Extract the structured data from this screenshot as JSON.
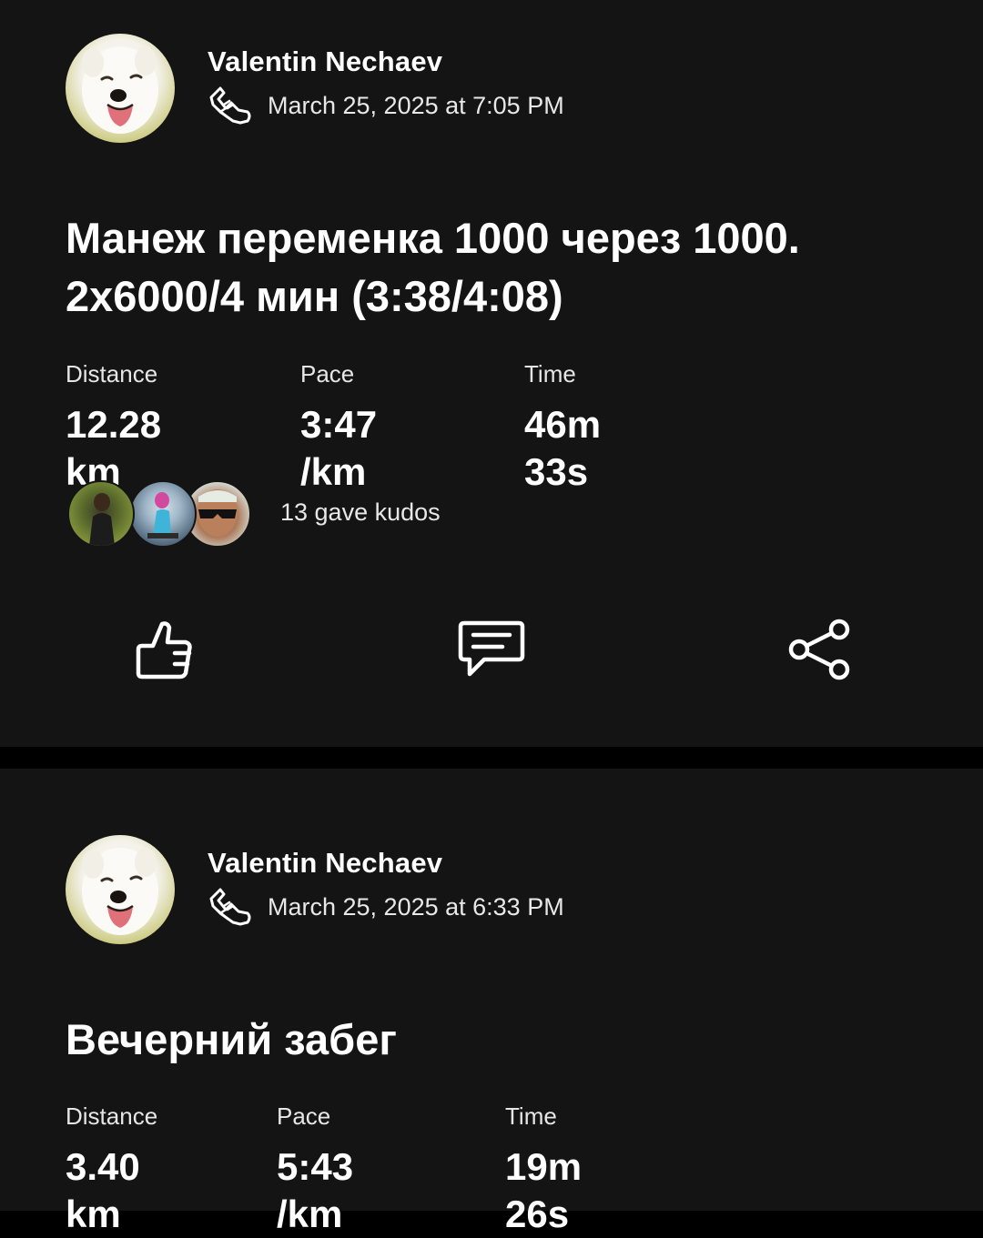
{
  "colors": {
    "background": "#000000",
    "card": "#141414",
    "text_primary": "#ffffff",
    "text_secondary": "#e8e8e8"
  },
  "activities": [
    {
      "athlete_name": "Valentin Nechaev",
      "activity_icon": "running-shoe-icon",
      "timestamp": "March 25, 2025 at 7:05 PM",
      "title": "Манеж переменка 1000 через 1000. 2х6000/4 мин (3:38/4:08)",
      "stats": [
        {
          "label": "Distance",
          "value": "12.28 km"
        },
        {
          "label": "Pace",
          "value": "3:47 /km"
        },
        {
          "label": "Time",
          "value": "46m 33s"
        }
      ],
      "kudos": {
        "text": "13 gave kudos"
      },
      "actions": [
        {
          "icon": "thumbs-up-icon"
        },
        {
          "icon": "comment-icon"
        },
        {
          "icon": "share-icon"
        }
      ]
    },
    {
      "athlete_name": "Valentin Nechaev",
      "activity_icon": "running-shoe-icon",
      "timestamp": "March 25, 2025 at 6:33 PM",
      "title": "Вечерний забег",
      "stats": [
        {
          "label": "Distance",
          "value": "3.40 km"
        },
        {
          "label": "Pace",
          "value": "5:43 /km"
        },
        {
          "label": "Time",
          "value": "19m 26s"
        }
      ]
    }
  ]
}
